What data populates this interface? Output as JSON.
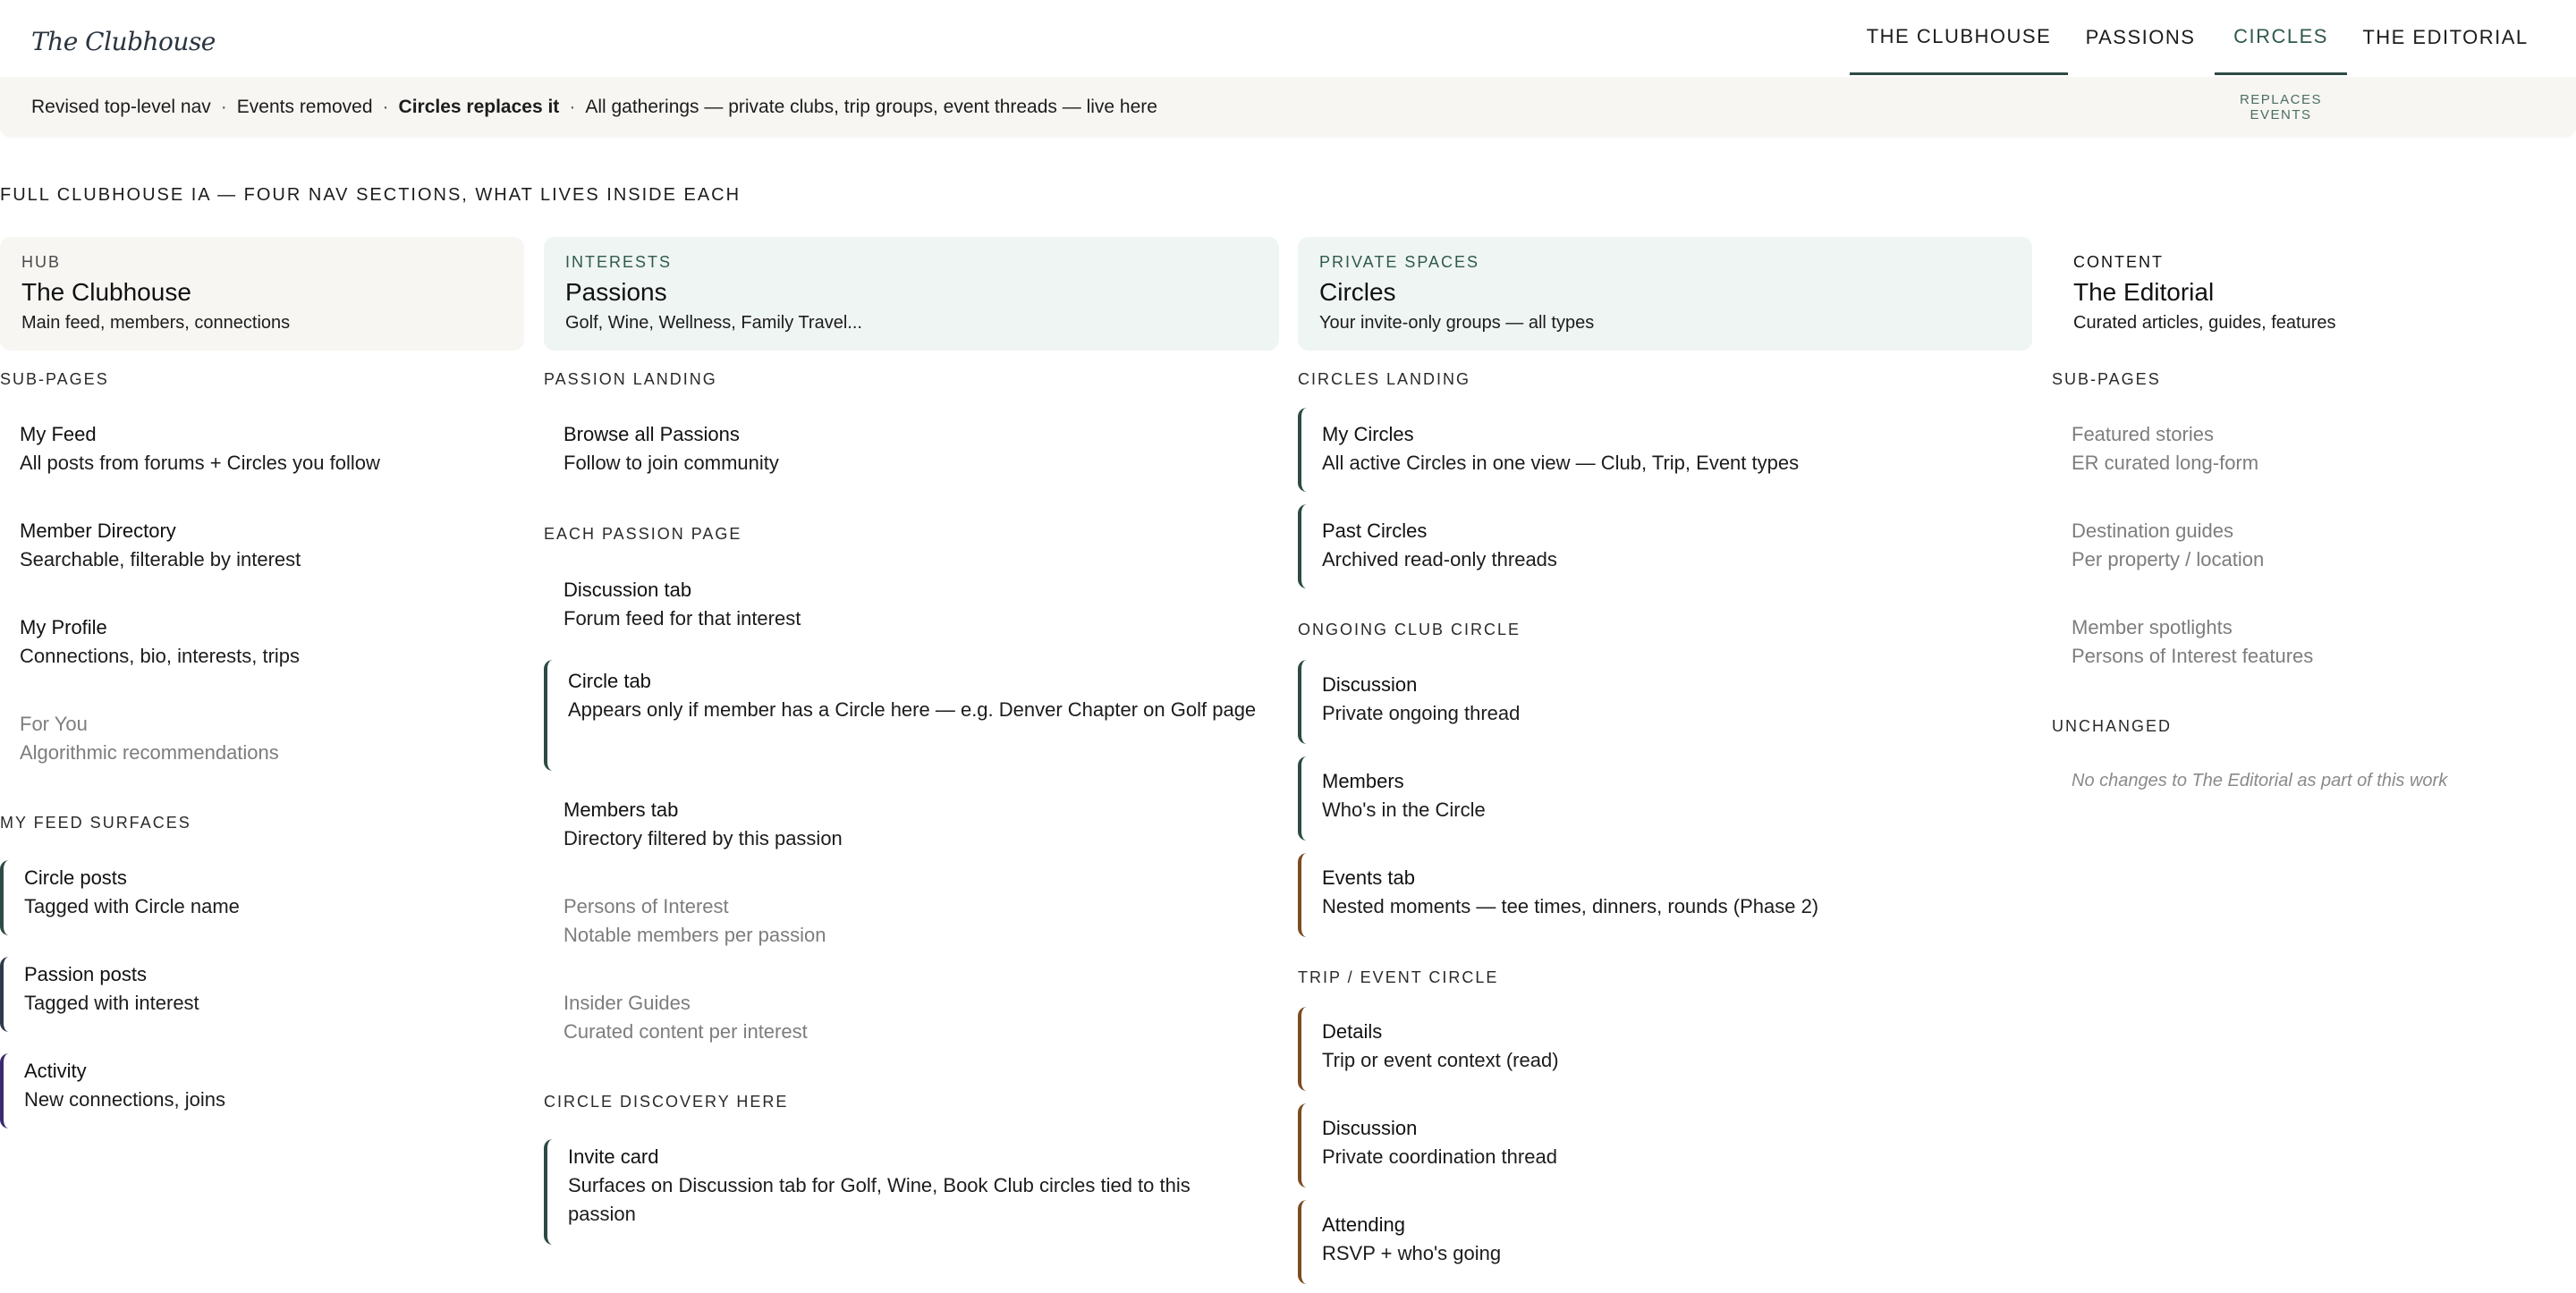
{
  "logo": "The Clubhouse",
  "nav": {
    "tabs": [
      "THE CLUBHOUSE",
      "PASSIONS",
      "CIRCLES",
      "THE EDITORIAL"
    ],
    "circles_note": "REPLACES EVENTS"
  },
  "banner": {
    "part1": "Revised top-level nav",
    "sep": "·",
    "part2": "Events removed",
    "part3": "Circles replaces it",
    "part4": "All gatherings — private clubs, trip groups, event threads — live here"
  },
  "heading": "FULL CLUBHOUSE IA — FOUR NAV SECTIONS, WHAT LIVES INSIDE EACH",
  "columns": {
    "clubhouse": {
      "tag": "HUB",
      "title": "The Clubhouse",
      "subtitle": "Main feed, members, connections",
      "subpages_label": "SUB-PAGES",
      "items": [
        {
          "title": "My Feed",
          "desc": "All posts from forums + Circles you follow"
        },
        {
          "title": "Member Directory",
          "desc": "Searchable, filterable by interest"
        },
        {
          "title": "My Profile",
          "desc": "Connections, bio, interests, trips"
        },
        {
          "title": "For You",
          "desc": "Algorithmic recommendations"
        }
      ],
      "surfaces_label": "MY FEED SURFACES",
      "surfaces": [
        {
          "title": "Circle posts",
          "desc": "Tagged with Circle name"
        },
        {
          "title": "Passion posts",
          "desc": "Tagged with interest"
        },
        {
          "title": "Activity",
          "desc": "New connections, joins"
        }
      ]
    },
    "passions": {
      "tag": "INTERESTS",
      "title": "Passions",
      "subtitle": "Golf, Wine, Wellness, Family Travel...",
      "landing_label": "PASSION LANDING",
      "landing": [
        {
          "title": "Browse all Passions",
          "desc": "Follow to join community"
        }
      ],
      "page_label": "EACH PASSION PAGE",
      "page_items": [
        {
          "title": "Discussion tab",
          "desc": "Forum feed for that interest"
        },
        {
          "title": "Circle tab",
          "desc": "Appears only if member has a Circle here — e.g. Denver Chapter on Golf page"
        },
        {
          "title": "Members tab",
          "desc": "Directory filtered by this passion"
        },
        {
          "title": "Persons of Interest",
          "desc": "Notable members per passion"
        },
        {
          "title": "Insider Guides",
          "desc": "Curated content per interest"
        }
      ],
      "discovery_label": "CIRCLE DISCOVERY HERE",
      "discovery": [
        {
          "title": "Invite card",
          "desc": "Surfaces on Discussion tab for Golf, Wine, Book Club circles tied to this passion"
        }
      ]
    },
    "circles": {
      "tag": "PRIVATE SPACES",
      "title": "Circles",
      "subtitle": "Your invite-only groups — all types",
      "landing_label": "CIRCLES LANDING",
      "landing": [
        {
          "title": "My Circles",
          "desc": "All active Circles in one view — Club, Trip, Event types"
        },
        {
          "title": "Past Circles",
          "desc": "Archived read-only threads"
        }
      ],
      "club_label": "ONGOING CLUB CIRCLE",
      "club": [
        {
          "title": "Discussion",
          "desc": "Private ongoing thread"
        },
        {
          "title": "Members",
          "desc": "Who's in the Circle"
        },
        {
          "title": "Events tab",
          "desc": "Nested moments — tee times, dinners, rounds (Phase 2)"
        }
      ],
      "trip_label": "TRIP / EVENT CIRCLE",
      "trip": [
        {
          "title": "Details",
          "desc": "Trip or event context (read)"
        },
        {
          "title": "Discussion",
          "desc": "Private coordination thread"
        },
        {
          "title": "Attending",
          "desc": "RSVP + who's going"
        }
      ]
    },
    "editorial": {
      "tag": "CONTENT",
      "title": "The Editorial",
      "subtitle": "Curated articles, guides, features",
      "subpages_label": "SUB-PAGES",
      "items": [
        {
          "title": "Featured stories",
          "desc": "ER curated long-form"
        },
        {
          "title": "Destination guides",
          "desc": "Per property / location"
        },
        {
          "title": "Member spotlights",
          "desc": "Persons of Interest features"
        }
      ],
      "unchanged_label": "UNCHANGED",
      "note": "No changes to The Editorial as part of this work"
    }
  },
  "colors": {
    "accent_green": "#2e4a45",
    "accent_brown": "#7a4d22",
    "accent_navy": "#2c3a4a",
    "accent_purple": "#3a2a6e",
    "green_panel": "#eff5f2",
    "neutral_panel": "#f7f6f3"
  }
}
